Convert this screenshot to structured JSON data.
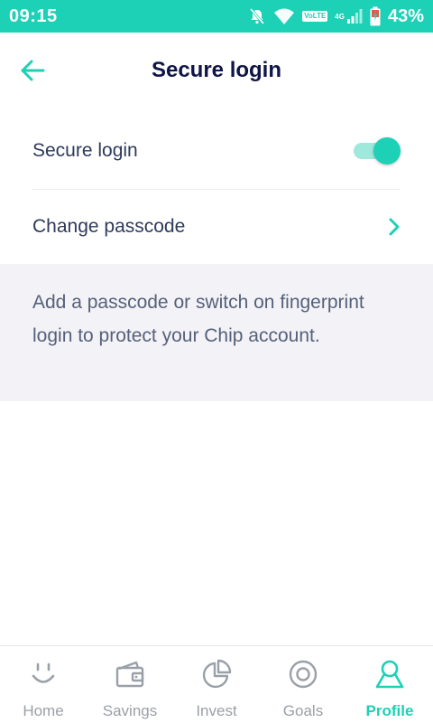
{
  "status_bar": {
    "time": "09:15",
    "volte": "VoLTE",
    "network": "4G",
    "battery": "43%",
    "icons": [
      "bell-off-icon",
      "wifi-icon",
      "signal-icon",
      "battery-icon"
    ]
  },
  "header": {
    "title": "Secure login",
    "back_icon": "arrow-left-icon"
  },
  "settings": {
    "secure_login_label": "Secure login",
    "secure_login_enabled": true,
    "change_passcode_label": "Change passcode"
  },
  "info": {
    "text": "Add a passcode or switch on fingerprint login to protect your Chip account."
  },
  "nav": {
    "items": [
      {
        "label": "Home",
        "icon": "smile-icon",
        "active": false
      },
      {
        "label": "Savings",
        "icon": "wallet-icon",
        "active": false
      },
      {
        "label": "Invest",
        "icon": "pie-chart-icon",
        "active": false
      },
      {
        "label": "Goals",
        "icon": "target-icon",
        "active": false
      },
      {
        "label": "Profile",
        "icon": "user-icon",
        "active": true
      }
    ]
  },
  "colors": {
    "accent": "#1dd1b6",
    "title": "#0f1546",
    "text": "#2e3a5c",
    "inactive": "#9aa0a8"
  }
}
